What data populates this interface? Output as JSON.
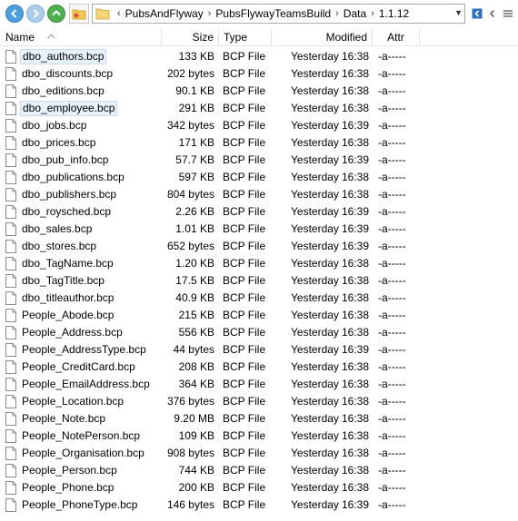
{
  "address": {
    "crumbs": [
      "PubsAndFlyway",
      "PubsFlywayTeamsBuild",
      "Data",
      "1.1.12"
    ]
  },
  "columns": {
    "name": "Name",
    "size": "Size",
    "type": "Type",
    "modified": "Modified",
    "attr": "Attr"
  },
  "files": [
    {
      "name": "dbo_authors.bcp",
      "size": "133 KB",
      "type": "BCP File",
      "day": "Yesterday",
      "time": "16:38",
      "attr": "-a-----",
      "selected": true
    },
    {
      "name": "dbo_discounts.bcp",
      "size": "202 bytes",
      "type": "BCP File",
      "day": "Yesterday",
      "time": "16:38",
      "attr": "-a-----"
    },
    {
      "name": "dbo_editions.bcp",
      "size": "90.1 KB",
      "type": "BCP File",
      "day": "Yesterday",
      "time": "16:38",
      "attr": "-a-----"
    },
    {
      "name": "dbo_employee.bcp",
      "size": "291 KB",
      "type": "BCP File",
      "day": "Yesterday",
      "time": "16:38",
      "attr": "-a-----",
      "selected": true
    },
    {
      "name": "dbo_jobs.bcp",
      "size": "342 bytes",
      "type": "BCP File",
      "day": "Yesterday",
      "time": "16:39",
      "attr": "-a-----"
    },
    {
      "name": "dbo_prices.bcp",
      "size": "171 KB",
      "type": "BCP File",
      "day": "Yesterday",
      "time": "16:38",
      "attr": "-a-----"
    },
    {
      "name": "dbo_pub_info.bcp",
      "size": "57.7 KB",
      "type": "BCP File",
      "day": "Yesterday",
      "time": "16:39",
      "attr": "-a-----"
    },
    {
      "name": "dbo_publications.bcp",
      "size": "597 KB",
      "type": "BCP File",
      "day": "Yesterday",
      "time": "16:38",
      "attr": "-a-----"
    },
    {
      "name": "dbo_publishers.bcp",
      "size": "804 bytes",
      "type": "BCP File",
      "day": "Yesterday",
      "time": "16:38",
      "attr": "-a-----"
    },
    {
      "name": "dbo_roysched.bcp",
      "size": "2.26 KB",
      "type": "BCP File",
      "day": "Yesterday",
      "time": "16:39",
      "attr": "-a-----"
    },
    {
      "name": "dbo_sales.bcp",
      "size": "1.01 KB",
      "type": "BCP File",
      "day": "Yesterday",
      "time": "16:39",
      "attr": "-a-----"
    },
    {
      "name": "dbo_stores.bcp",
      "size": "652 bytes",
      "type": "BCP File",
      "day": "Yesterday",
      "time": "16:39",
      "attr": "-a-----"
    },
    {
      "name": "dbo_TagName.bcp",
      "size": "1.20 KB",
      "type": "BCP File",
      "day": "Yesterday",
      "time": "16:38",
      "attr": "-a-----"
    },
    {
      "name": "dbo_TagTitle.bcp",
      "size": "17.5 KB",
      "type": "BCP File",
      "day": "Yesterday",
      "time": "16:38",
      "attr": "-a-----"
    },
    {
      "name": "dbo_titleauthor.bcp",
      "size": "40.9 KB",
      "type": "BCP File",
      "day": "Yesterday",
      "time": "16:38",
      "attr": "-a-----"
    },
    {
      "name": "People_Abode.bcp",
      "size": "215 KB",
      "type": "BCP File",
      "day": "Yesterday",
      "time": "16:38",
      "attr": "-a-----"
    },
    {
      "name": "People_Address.bcp",
      "size": "556 KB",
      "type": "BCP File",
      "day": "Yesterday",
      "time": "16:38",
      "attr": "-a-----"
    },
    {
      "name": "People_AddressType.bcp",
      "size": "44 bytes",
      "type": "BCP File",
      "day": "Yesterday",
      "time": "16:39",
      "attr": "-a-----"
    },
    {
      "name": "People_CreditCard.bcp",
      "size": "208 KB",
      "type": "BCP File",
      "day": "Yesterday",
      "time": "16:38",
      "attr": "-a-----"
    },
    {
      "name": "People_EmailAddress.bcp",
      "size": "364 KB",
      "type": "BCP File",
      "day": "Yesterday",
      "time": "16:38",
      "attr": "-a-----"
    },
    {
      "name": "People_Location.bcp",
      "size": "376 bytes",
      "type": "BCP File",
      "day": "Yesterday",
      "time": "16:38",
      "attr": "-a-----"
    },
    {
      "name": "People_Note.bcp",
      "size": "9.20 MB",
      "type": "BCP File",
      "day": "Yesterday",
      "time": "16:38",
      "attr": "-a-----"
    },
    {
      "name": "People_NotePerson.bcp",
      "size": "109 KB",
      "type": "BCP File",
      "day": "Yesterday",
      "time": "16:38",
      "attr": "-a-----"
    },
    {
      "name": "People_Organisation.bcp",
      "size": "908 bytes",
      "type": "BCP File",
      "day": "Yesterday",
      "time": "16:38",
      "attr": "-a-----"
    },
    {
      "name": "People_Person.bcp",
      "size": "744 KB",
      "type": "BCP File",
      "day": "Yesterday",
      "time": "16:38",
      "attr": "-a-----"
    },
    {
      "name": "People_Phone.bcp",
      "size": "200 KB",
      "type": "BCP File",
      "day": "Yesterday",
      "time": "16:38",
      "attr": "-a-----"
    },
    {
      "name": "People_PhoneType.bcp",
      "size": "146 bytes",
      "type": "BCP File",
      "day": "Yesterday",
      "time": "16:39",
      "attr": "-a-----"
    }
  ]
}
